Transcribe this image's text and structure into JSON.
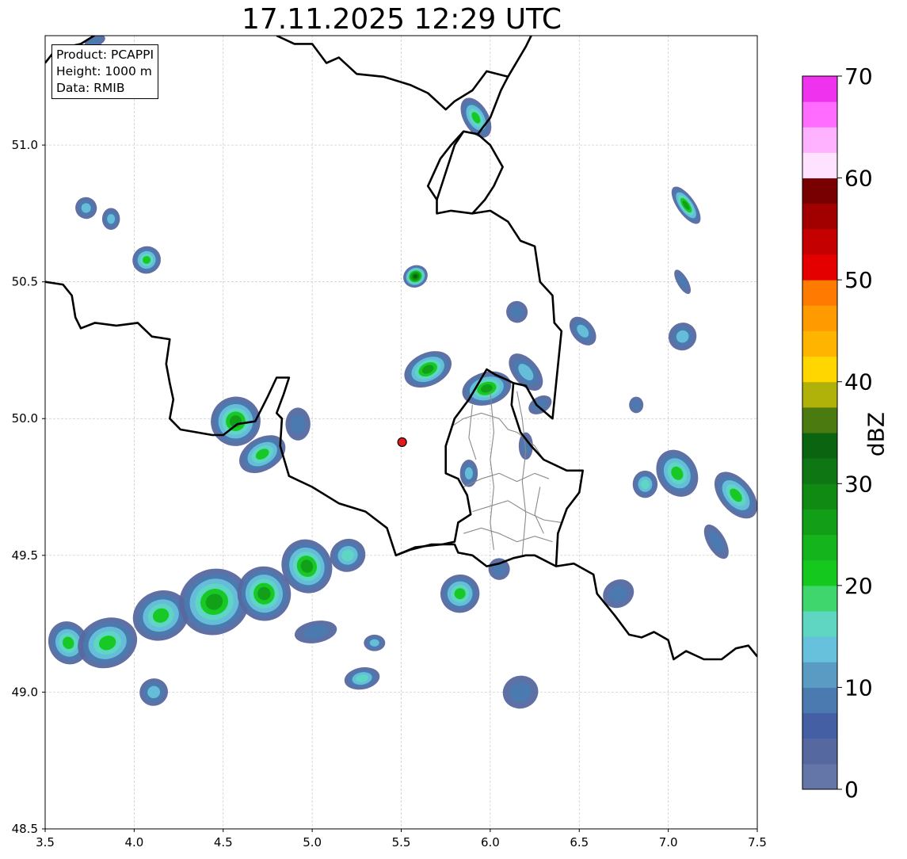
{
  "title": "17.11.2025 12:29 UTC",
  "info": {
    "product": "Product: PCAPPI",
    "height": "Height: 1000 m",
    "data": "Data: RMIB"
  },
  "map": {
    "lon_range": [
      3.5,
      7.5
    ],
    "lat_range": [
      48.5,
      51.4
    ],
    "x_ticks": [
      "3.5",
      "4.0",
      "4.5",
      "5.0",
      "5.5",
      "6.0",
      "6.5",
      "7.0",
      "7.5"
    ],
    "x_tick_values": [
      3.5,
      4.0,
      4.5,
      5.0,
      5.5,
      6.0,
      6.5,
      7.0,
      7.5
    ],
    "y_ticks": [
      "48.5",
      "49.0",
      "49.5",
      "50.0",
      "50.5",
      "51.0"
    ],
    "y_tick_values": [
      48.5,
      49.0,
      49.5,
      50.0,
      50.5,
      51.0
    ],
    "grid": true,
    "radar_site": {
      "lon": 5.505,
      "lat": 49.914,
      "color": "#e31a1c"
    }
  },
  "colorbar": {
    "label": "dBZ",
    "range": [
      0,
      70
    ],
    "step": 2.5,
    "tick_labels": [
      "0",
      "10",
      "20",
      "30",
      "40",
      "50",
      "60",
      "70"
    ],
    "tick_values": [
      0,
      10,
      20,
      30,
      40,
      50,
      60,
      70
    ],
    "colors": [
      "#6475a7",
      "#5668a0",
      "#455fa4",
      "#4a7ab0",
      "#5a9bc3",
      "#67c1dc",
      "#5fd6c2",
      "#3ed66d",
      "#14c81e",
      "#14b41c",
      "#139e18",
      "#118a14",
      "#0e7612",
      "#0a6410",
      "#4a7a10",
      "#b0b20a",
      "#ffd600",
      "#ffb400",
      "#ff9a00",
      "#ff7a00",
      "#e50000",
      "#c40000",
      "#a20000",
      "#780000",
      "#ffe2ff",
      "#ffb2ff",
      "#ff6cff",
      "#ee32ee"
    ]
  },
  "echoes": [
    {
      "name": "west-band-cell-1",
      "lon": 3.63,
      "lat": 49.18,
      "rx": 0.11,
      "ry": 0.08,
      "angle": -25,
      "peak": 22
    },
    {
      "name": "west-band-cell-2",
      "lon": 3.85,
      "lat": 49.18,
      "rx": 0.17,
      "ry": 0.09,
      "angle": -20,
      "peak": 22
    },
    {
      "name": "west-band-cell-3",
      "lon": 4.15,
      "lat": 49.28,
      "rx": 0.16,
      "ry": 0.09,
      "angle": -22,
      "peak": 24
    },
    {
      "name": "west-band-cell-4",
      "lon": 4.45,
      "lat": 49.33,
      "rx": 0.2,
      "ry": 0.12,
      "angle": -22,
      "peak": 27
    },
    {
      "name": "west-band-cell-5",
      "lon": 4.73,
      "lat": 49.36,
      "rx": 0.15,
      "ry": 0.1,
      "angle": -22,
      "peak": 25
    },
    {
      "name": "west-band-cell-6",
      "lon": 4.97,
      "lat": 49.46,
      "rx": 0.14,
      "ry": 0.1,
      "angle": -25,
      "peak": 28
    },
    {
      "name": "west-band-cell-7",
      "lon": 5.2,
      "lat": 49.5,
      "rx": 0.1,
      "ry": 0.06,
      "angle": -20,
      "peak": 18
    },
    {
      "name": "band-tail-1",
      "lon": 5.02,
      "lat": 49.22,
      "rx": 0.12,
      "ry": 0.04,
      "angle": -10,
      "peak": 12
    },
    {
      "name": "band-tail-2",
      "lon": 5.35,
      "lat": 49.18,
      "rx": 0.06,
      "ry": 0.03,
      "angle": 0,
      "peak": 16
    },
    {
      "name": "south-cell-1",
      "lon": 4.11,
      "lat": 49.0,
      "rx": 0.08,
      "ry": 0.05,
      "angle": -20,
      "peak": 16
    },
    {
      "name": "south-cell-2",
      "lon": 5.28,
      "lat": 49.05,
      "rx": 0.1,
      "ry": 0.04,
      "angle": -10,
      "peak": 18
    },
    {
      "name": "south-cell-3",
      "lon": 6.17,
      "lat": 49.0,
      "rx": 0.1,
      "ry": 0.06,
      "angle": -15,
      "peak": 12
    },
    {
      "name": "gaume-cell",
      "lon": 5.83,
      "lat": 49.36,
      "rx": 0.11,
      "ry": 0.07,
      "angle": -15,
      "peak": 22
    },
    {
      "name": "gaume-cell-small",
      "lon": 6.05,
      "lat": 49.45,
      "rx": 0.06,
      "ry": 0.04,
      "angle": -20,
      "peak": 12
    },
    {
      "name": "semois-cell-1",
      "lon": 4.57,
      "lat": 49.99,
      "rx": 0.14,
      "ry": 0.09,
      "angle": -30,
      "peak": 27
    },
    {
      "name": "semois-cell-2",
      "lon": 4.72,
      "lat": 49.87,
      "rx": 0.14,
      "ry": 0.06,
      "angle": -30,
      "peak": 22
    },
    {
      "name": "semois-cell-3",
      "lon": 4.92,
      "lat": 49.98,
      "rx": 0.07,
      "ry": 0.06,
      "angle": 0,
      "peak": 12
    },
    {
      "name": "ardennes-cell-1",
      "lon": 5.65,
      "lat": 50.18,
      "rx": 0.14,
      "ry": 0.06,
      "angle": -25,
      "peak": 25
    },
    {
      "name": "ardennes-cell-2",
      "lon": 5.98,
      "lat": 50.11,
      "rx": 0.14,
      "ry": 0.06,
      "angle": -15,
      "peak": 27
    },
    {
      "name": "ardennes-cell-3",
      "lon": 6.2,
      "lat": 50.17,
      "rx": 0.07,
      "ry": 0.08,
      "angle": -40,
      "peak": 15
    },
    {
      "name": "lux-north-cell",
      "lon": 6.2,
      "lat": 49.9,
      "rx": 0.04,
      "ry": 0.05,
      "angle": 0,
      "peak": 12
    },
    {
      "name": "lux-west-cell",
      "lon": 5.88,
      "lat": 49.8,
      "rx": 0.05,
      "ry": 0.05,
      "angle": 0,
      "peak": 14
    },
    {
      "name": "liege-cell",
      "lon": 5.58,
      "lat": 50.52,
      "rx": 0.07,
      "ry": 0.04,
      "angle": -25,
      "peak": 35
    },
    {
      "name": "eifel-cell-1",
      "lon": 6.15,
      "lat": 50.39,
      "rx": 0.06,
      "ry": 0.04,
      "angle": -20,
      "peak": 12
    },
    {
      "name": "eifel-cell-2",
      "lon": 6.52,
      "lat": 50.32,
      "rx": 0.06,
      "ry": 0.06,
      "angle": -40,
      "peak": 14
    },
    {
      "name": "eifel-cell-3",
      "lon": 6.28,
      "lat": 50.05,
      "rx": 0.07,
      "ry": 0.03,
      "angle": -30,
      "peak": 10
    },
    {
      "name": "maastricht-cell",
      "lon": 5.92,
      "lat": 51.1,
      "rx": 0.07,
      "ry": 0.08,
      "angle": -30,
      "peak": 22
    },
    {
      "name": "ne-cell-1",
      "lon": 7.1,
      "lat": 50.78,
      "rx": 0.05,
      "ry": 0.08,
      "angle": -35,
      "peak": 25
    },
    {
      "name": "ne-cell-2",
      "lon": 7.08,
      "lat": 50.3,
      "rx": 0.08,
      "ry": 0.05,
      "angle": -40,
      "peak": 14
    },
    {
      "name": "ne-cell-3",
      "lon": 7.08,
      "lat": 50.5,
      "rx": 0.03,
      "ry": 0.05,
      "angle": -30,
      "peak": 10
    },
    {
      "name": "nw-cell-1",
      "lon": 3.73,
      "lat": 50.77,
      "rx": 0.06,
      "ry": 0.04,
      "angle": -30,
      "peak": 14
    },
    {
      "name": "nw-cell-2",
      "lon": 3.87,
      "lat": 50.73,
      "rx": 0.05,
      "ry": 0.04,
      "angle": 0,
      "peak": 16
    },
    {
      "name": "nw-cell-3",
      "lon": 4.07,
      "lat": 50.58,
      "rx": 0.08,
      "ry": 0.05,
      "angle": -20,
      "peak": 22
    },
    {
      "name": "nw-cell-4",
      "lon": 3.78,
      "lat": 51.38,
      "rx": 0.06,
      "ry": 0.02,
      "angle": -20,
      "peak": 8
    },
    {
      "name": "east-cell-1",
      "lon": 7.05,
      "lat": 49.8,
      "rx": 0.11,
      "ry": 0.09,
      "angle": -30,
      "peak": 22
    },
    {
      "name": "east-cell-2",
      "lon": 7.38,
      "lat": 49.72,
      "rx": 0.09,
      "ry": 0.1,
      "angle": -40,
      "peak": 22
    },
    {
      "name": "east-cell-3",
      "lon": 7.27,
      "lat": 49.55,
      "rx": 0.05,
      "ry": 0.07,
      "angle": -30,
      "peak": 12
    },
    {
      "name": "east-cell-4",
      "lon": 6.87,
      "lat": 49.76,
      "rx": 0.07,
      "ry": 0.05,
      "angle": 0,
      "peak": 20
    },
    {
      "name": "saar-cell",
      "lon": 6.72,
      "lat": 49.36,
      "rx": 0.09,
      "ry": 0.05,
      "angle": -30,
      "peak": 12
    },
    {
      "name": "east-cell-5",
      "lon": 6.82,
      "lat": 50.05,
      "rx": 0.04,
      "ry": 0.03,
      "angle": 0,
      "peak": 12
    }
  ],
  "borders": {
    "country": [
      [
        [
          3.5,
          50.5
        ],
        [
          3.6,
          50.49
        ],
        [
          3.65,
          50.45
        ],
        [
          3.67,
          50.37
        ],
        [
          3.7,
          50.33
        ],
        [
          3.78,
          50.35
        ],
        [
          3.9,
          50.34
        ],
        [
          4.02,
          50.35
        ],
        [
          4.1,
          50.3
        ],
        [
          4.2,
          50.29
        ],
        [
          4.18,
          50.2
        ],
        [
          4.2,
          50.13
        ],
        [
          4.22,
          50.07
        ],
        [
          4.2,
          50.0
        ],
        [
          4.26,
          49.96
        ],
        [
          4.44,
          49.94
        ],
        [
          4.5,
          49.94
        ],
        [
          4.58,
          49.98
        ],
        [
          4.68,
          49.99
        ],
        [
          4.75,
          50.08
        ],
        [
          4.8,
          50.15
        ],
        [
          4.87,
          50.15
        ],
        [
          4.84,
          50.09
        ],
        [
          4.8,
          50.02
        ],
        [
          4.83,
          50.0
        ],
        [
          4.82,
          49.9
        ],
        [
          4.87,
          49.79
        ],
        [
          5.0,
          49.75
        ],
        [
          5.1,
          49.71
        ],
        [
          5.15,
          49.69
        ],
        [
          5.3,
          49.66
        ],
        [
          5.42,
          49.6
        ],
        [
          5.47,
          49.5
        ],
        [
          5.55,
          49.52
        ],
        [
          5.67,
          49.54
        ],
        [
          5.73,
          49.54
        ],
        [
          5.8,
          49.54
        ],
        [
          5.82,
          49.51
        ],
        [
          5.9,
          49.5
        ],
        [
          5.98,
          49.46
        ],
        [
          6.05,
          49.47
        ],
        [
          6.13,
          49.49
        ],
        [
          6.2,
          49.5
        ],
        [
          6.25,
          49.5
        ],
        [
          6.37,
          49.46
        ],
        [
          6.47,
          49.47
        ],
        [
          6.58,
          49.43
        ],
        [
          6.6,
          49.36
        ],
        [
          6.7,
          49.28
        ],
        [
          6.78,
          49.21
        ],
        [
          6.85,
          49.2
        ],
        [
          6.92,
          49.22
        ],
        [
          7.0,
          49.19
        ],
        [
          7.03,
          49.12
        ],
        [
          7.1,
          49.15
        ],
        [
          7.2,
          49.12
        ],
        [
          7.3,
          49.12
        ],
        [
          7.38,
          49.16
        ],
        [
          7.45,
          49.17
        ],
        [
          7.5,
          49.13
        ]
      ],
      [
        [
          5.47,
          49.5
        ],
        [
          5.58,
          49.53
        ],
        [
          5.73,
          49.54
        ],
        [
          5.8,
          49.55
        ],
        [
          5.82,
          49.62
        ],
        [
          5.89,
          49.65
        ],
        [
          5.87,
          49.72
        ],
        [
          5.82,
          49.78
        ],
        [
          5.75,
          49.8
        ],
        [
          5.75,
          49.9
        ],
        [
          5.8,
          50.0
        ],
        [
          5.88,
          50.07
        ],
        [
          5.98,
          50.18
        ],
        [
          6.03,
          50.16
        ],
        [
          6.1,
          50.14
        ],
        [
          6.13,
          50.13
        ],
        [
          6.12,
          50.05
        ],
        [
          6.17,
          49.95
        ],
        [
          6.23,
          49.9
        ],
        [
          6.3,
          49.85
        ],
        [
          6.43,
          49.81
        ],
        [
          6.52,
          49.81
        ],
        [
          6.5,
          49.73
        ],
        [
          6.43,
          49.67
        ],
        [
          6.38,
          49.58
        ],
        [
          6.37,
          49.46
        ]
      ],
      [
        [
          6.13,
          50.13
        ],
        [
          6.2,
          50.12
        ],
        [
          6.26,
          50.05
        ],
        [
          6.35,
          50.0
        ],
        [
          6.4,
          50.32
        ],
        [
          6.36,
          50.35
        ],
        [
          6.35,
          50.45
        ],
        [
          6.28,
          50.5
        ],
        [
          6.25,
          50.63
        ],
        [
          6.17,
          50.65
        ],
        [
          6.1,
          50.72
        ],
        [
          6.0,
          50.76
        ],
        [
          5.9,
          50.75
        ],
        [
          5.78,
          50.76
        ],
        [
          5.7,
          50.75
        ],
        [
          5.7,
          50.8
        ],
        [
          5.65,
          50.85
        ],
        [
          5.72,
          50.95
        ],
        [
          5.78,
          51.0
        ],
        [
          5.85,
          51.05
        ],
        [
          5.93,
          51.04
        ],
        [
          6.0,
          51.1
        ],
        [
          6.06,
          51.2
        ],
        [
          6.1,
          51.25
        ],
        [
          6.2,
          51.36
        ],
        [
          6.23,
          51.4
        ]
      ],
      [
        [
          5.9,
          50.75
        ],
        [
          5.97,
          50.8
        ],
        [
          6.02,
          50.85
        ],
        [
          6.07,
          50.92
        ],
        [
          6.0,
          51.0
        ],
        [
          5.93,
          51.04
        ]
      ],
      [
        [
          5.7,
          50.8
        ],
        [
          5.75,
          50.9
        ],
        [
          5.8,
          51.0
        ],
        [
          5.85,
          51.05
        ]
      ],
      [
        [
          4.8,
          51.4
        ],
        [
          4.9,
          51.37
        ],
        [
          5.0,
          51.37
        ],
        [
          5.08,
          51.3
        ],
        [
          5.15,
          51.32
        ],
        [
          5.25,
          51.26
        ],
        [
          5.4,
          51.25
        ],
        [
          5.55,
          51.22
        ],
        [
          5.65,
          51.19
        ],
        [
          5.75,
          51.13
        ],
        [
          5.8,
          51.16
        ],
        [
          5.9,
          51.2
        ],
        [
          5.98,
          51.27
        ],
        [
          6.1,
          51.25
        ]
      ],
      [
        [
          3.5,
          51.3
        ],
        [
          3.56,
          51.35
        ],
        [
          3.7,
          51.37
        ],
        [
          3.8,
          51.41
        ]
      ]
    ],
    "admin": [
      [
        [
          5.78,
          49.97
        ],
        [
          5.85,
          50.0
        ],
        [
          5.95,
          50.02
        ],
        [
          6.05,
          50.0
        ],
        [
          6.1,
          49.96
        ],
        [
          6.15,
          49.95
        ],
        [
          6.25,
          49.9
        ],
        [
          6.3,
          49.85
        ]
      ],
      [
        [
          5.85,
          49.75
        ],
        [
          5.95,
          49.78
        ],
        [
          6.05,
          49.8
        ],
        [
          6.15,
          49.77
        ],
        [
          6.25,
          49.8
        ],
        [
          6.33,
          49.78
        ]
      ],
      [
        [
          5.9,
          49.66
        ],
        [
          6.0,
          49.68
        ],
        [
          6.1,
          49.7
        ],
        [
          6.2,
          49.66
        ],
        [
          6.3,
          49.63
        ],
        [
          6.4,
          49.62
        ]
      ],
      [
        [
          5.85,
          49.58
        ],
        [
          5.95,
          49.6
        ],
        [
          6.05,
          49.58
        ],
        [
          6.15,
          49.55
        ],
        [
          6.25,
          49.57
        ],
        [
          6.35,
          49.55
        ]
      ],
      [
        [
          6.0,
          50.1
        ],
        [
          6.02,
          49.95
        ],
        [
          6.0,
          49.85
        ],
        [
          6.02,
          49.75
        ],
        [
          6.0,
          49.62
        ],
        [
          6.02,
          49.52
        ]
      ],
      [
        [
          6.15,
          50.1
        ],
        [
          6.18,
          50.0
        ],
        [
          6.2,
          49.88
        ],
        [
          6.18,
          49.77
        ],
        [
          6.2,
          49.65
        ],
        [
          6.18,
          49.5
        ]
      ],
      [
        [
          5.9,
          50.05
        ],
        [
          5.88,
          49.93
        ],
        [
          5.92,
          49.85
        ]
      ],
      [
        [
          6.28,
          49.75
        ],
        [
          6.25,
          49.65
        ],
        [
          6.3,
          49.58
        ]
      ]
    ]
  }
}
